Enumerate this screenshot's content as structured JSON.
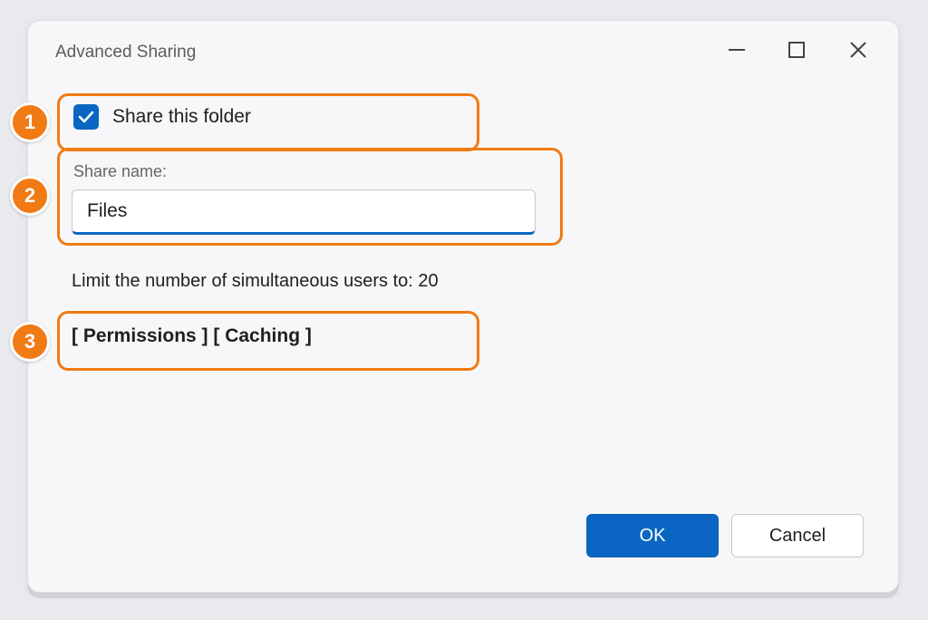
{
  "window": {
    "title": "Advanced Sharing",
    "controls": {
      "minimize": "minimize-icon",
      "maximize": "maximize-icon",
      "close": "close-icon"
    }
  },
  "callouts": [
    {
      "number": "1"
    },
    {
      "number": "2"
    },
    {
      "number": "3"
    }
  ],
  "share_checkbox": {
    "label": "Share this folder",
    "checked": true
  },
  "share_name": {
    "label": "Share name:",
    "value": "Files"
  },
  "limit_text": "Limit the number of simultaneous users to: 20",
  "tabs_text": "[ Permissions ] [ Caching ]",
  "buttons": {
    "ok": "OK",
    "cancel": "Cancel"
  },
  "colors": {
    "accent": "#0a66c2",
    "callout": "#f07a14"
  }
}
